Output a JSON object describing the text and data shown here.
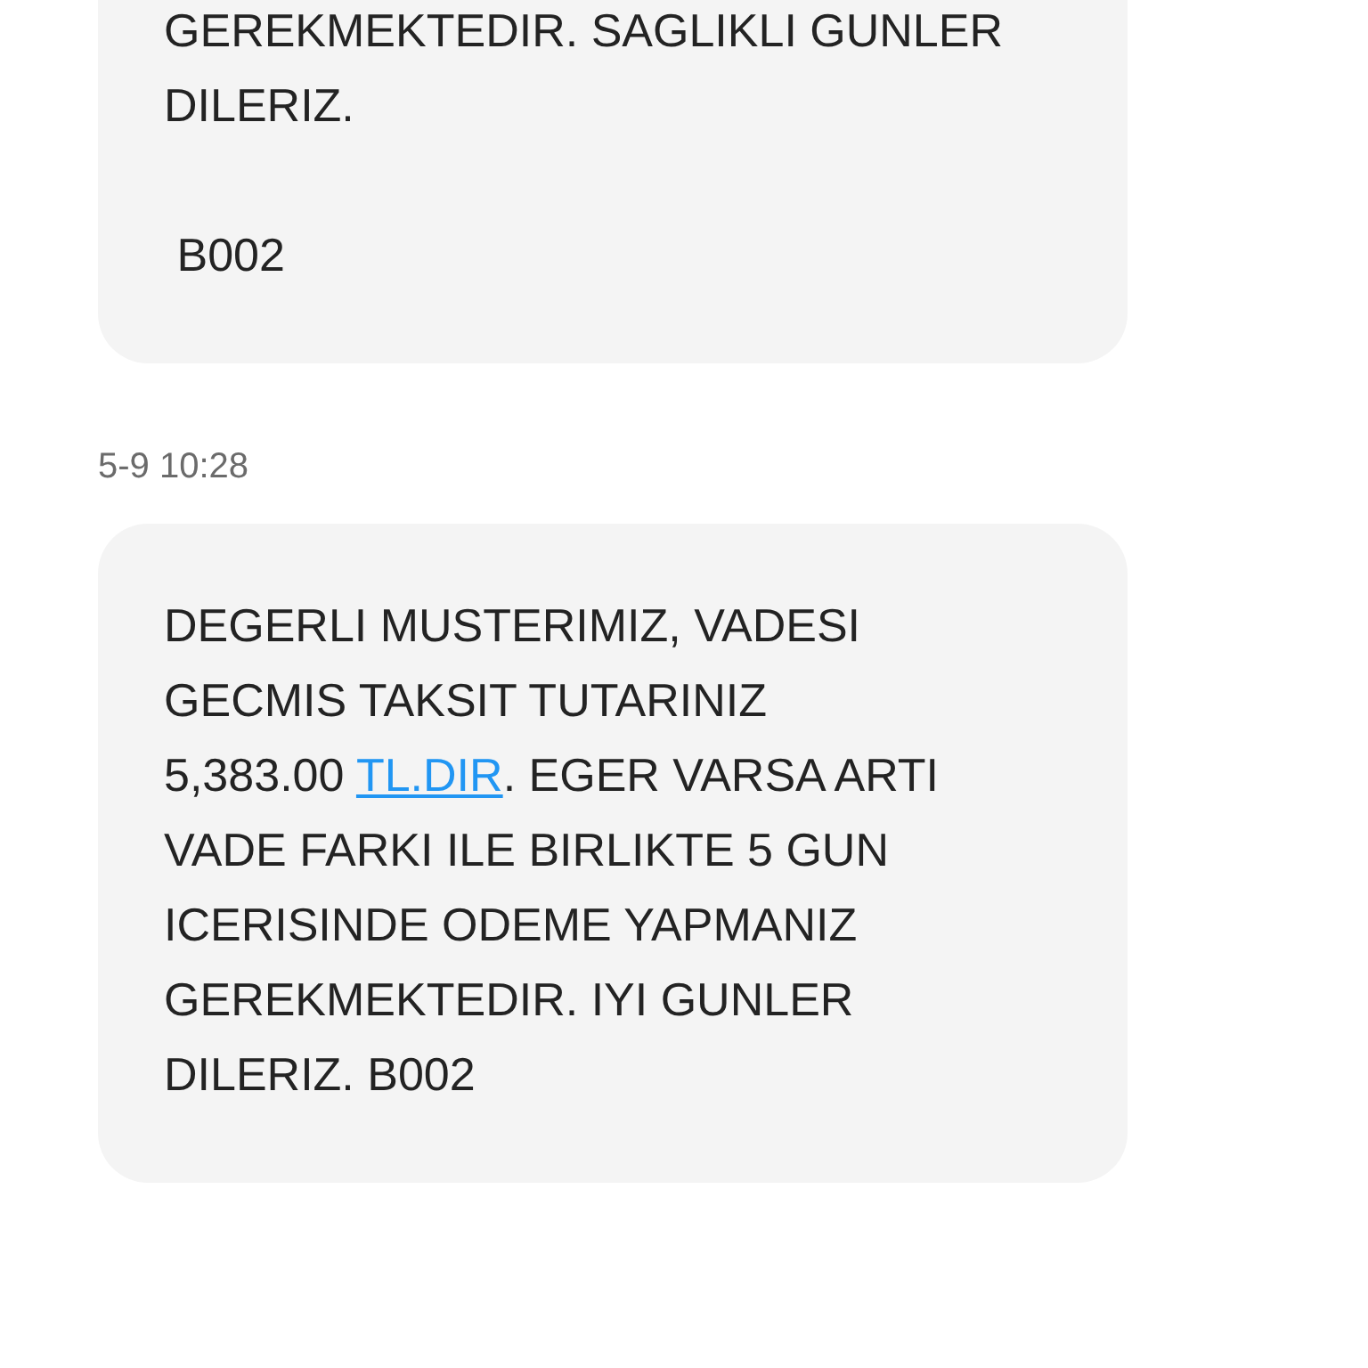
{
  "messages": [
    {
      "kind": "message",
      "parts": [
        {
          "kind": "text",
          "text": "GEREKMEKTEDIR. SAGLIKLI GUNLER\nDILERIZ.\n\n B002"
        }
      ]
    },
    {
      "kind": "timestamp",
      "text": "5-9 10:28"
    },
    {
      "kind": "message",
      "parts": [
        {
          "kind": "text",
          "text": "DEGERLI MUSTERIMIZ, VADESI\nGECMIS TAKSIT TUTARINIZ\n5,383.00 "
        },
        {
          "kind": "link",
          "text": "TL.DIR"
        },
        {
          "kind": "text",
          "text": ". EGER VARSA ARTI\nVADE FARKI ILE BIRLIKTE 5 GUN\nICERISINDE ODEME YAPMANIZ\nGEREKMEKTEDIR. IYI GUNLER\nDILERIZ. B002"
        }
      ]
    }
  ]
}
